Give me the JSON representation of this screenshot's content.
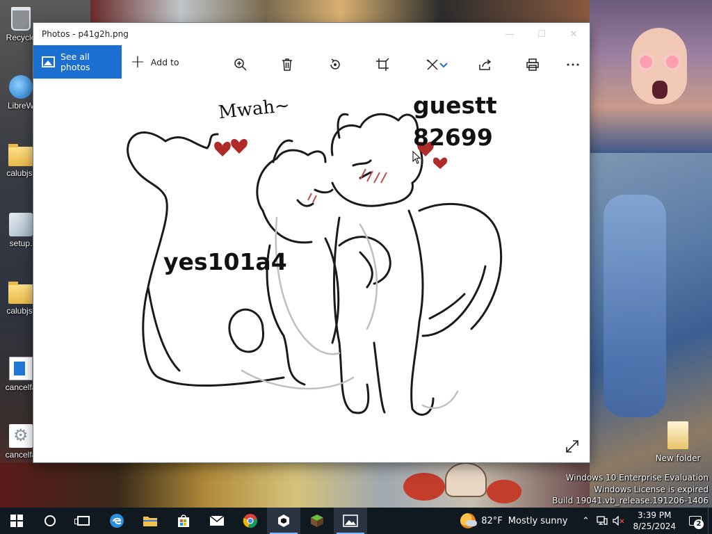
{
  "desktop": {
    "icons": [
      {
        "label": "Recycle"
      },
      {
        "label": "LibreW"
      },
      {
        "label": "calubjs-"
      },
      {
        "label": "setup."
      },
      {
        "label": "calubjs-"
      },
      {
        "label": "cancelfa"
      },
      {
        "label": "cancelfa"
      }
    ],
    "new_folder_label": "New folder",
    "watermark": {
      "line1": "Windows 10 Enterprise Evaluation",
      "line2": "Windows License is expired",
      "line3": "Build 19041.vb_release.191206-1406"
    }
  },
  "photos_window": {
    "title": "Photos - p41g2h.png",
    "toolbar": {
      "see_all_label": "See all photos",
      "add_to_label": "Add to",
      "icons": [
        "zoom-in-icon",
        "delete-icon",
        "rotate-icon",
        "crop-icon",
        "edit-icon",
        "share-icon",
        "print-icon",
        "more-icon"
      ]
    },
    "image": {
      "mwah_text": "Mwah~",
      "caption_top": "guestt 82699",
      "caption_top_line1": "guestt",
      "caption_top_line2": "82699",
      "caption_left": "yes101a4"
    }
  },
  "taskbar": {
    "weather": {
      "temp": "82°F",
      "condition": "Mostly sunny"
    },
    "clock": {
      "time": "3:39 PM",
      "date": "8/25/2024"
    },
    "notification_count": "2"
  },
  "colors": {
    "accent": "#1a6fd1",
    "taskbar": "#101820"
  }
}
